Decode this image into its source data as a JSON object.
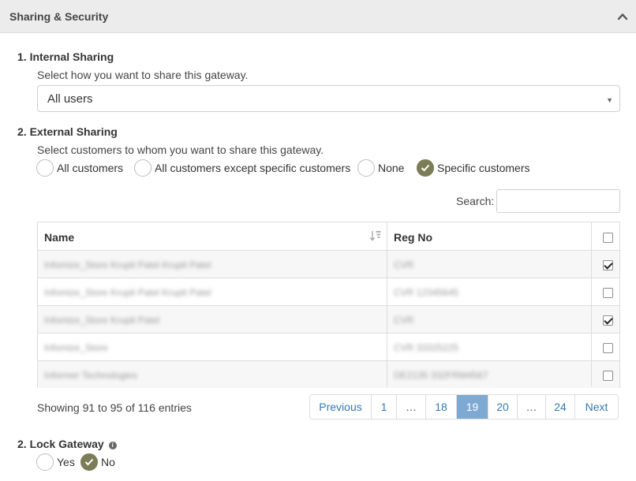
{
  "panel": {
    "title": "Sharing & Security"
  },
  "internal_sharing": {
    "title": "1. Internal Sharing",
    "help": "Select how you want to share this gateway.",
    "selected": "All users"
  },
  "external_sharing": {
    "title": "2. External Sharing",
    "help": "Select customers to whom you want to share this gateway.",
    "options": [
      {
        "label": "All customers",
        "checked": false
      },
      {
        "label": "All customers except specific customers",
        "checked": false
      },
      {
        "label": "None",
        "checked": false
      },
      {
        "label": "Specific customers",
        "checked": true
      }
    ]
  },
  "search": {
    "label": "Search:",
    "value": ""
  },
  "table": {
    "columns": [
      "Name",
      "Reg No"
    ],
    "rows": [
      {
        "name": "Infomize_Store Krupit Patel Krupit Patel",
        "reg": "CVR",
        "checked": true
      },
      {
        "name": "Infomize_Store Krupit Patel Krupit Patel",
        "reg": "CVR 12345645",
        "checked": false
      },
      {
        "name": "Infomize_Store Krupit Patel",
        "reg": "CVR",
        "checked": true
      },
      {
        "name": "Infomize_Store",
        "reg": "CVR 33325225",
        "checked": false
      },
      {
        "name": "Informer Technologies",
        "reg": "DE2135 332FRM4567",
        "checked": false
      }
    ]
  },
  "info": "Showing 91 to 95 of 116 entries",
  "pagination": {
    "previous": "Previous",
    "next": "Next",
    "pages": [
      "1",
      "…",
      "18",
      "19",
      "20",
      "…",
      "24"
    ],
    "active": "19"
  },
  "lock_gateway": {
    "title": "2. Lock Gateway",
    "options": [
      {
        "label": "Yes",
        "checked": false
      },
      {
        "label": "No",
        "checked": true
      }
    ]
  },
  "colors": {
    "accent": "#7b7d57",
    "pagination_active": "#7ea9d3",
    "link": "#337ab7"
  }
}
